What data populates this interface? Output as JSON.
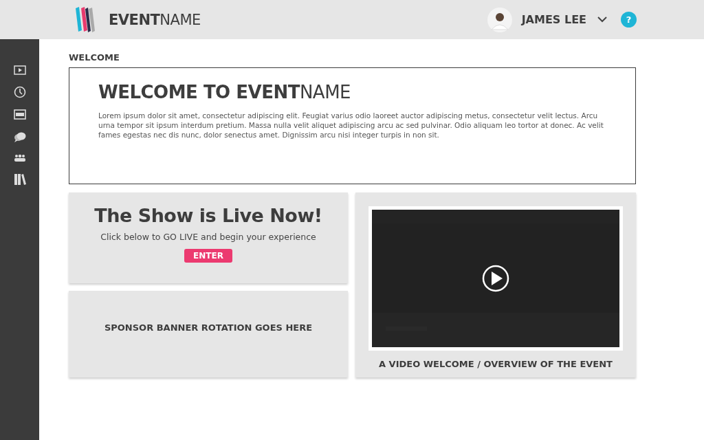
{
  "header": {
    "logo": "**EVENT**NAME",
    "user": {
      "name": "JAMES LEE"
    },
    "help": "?"
  },
  "welcome": {
    "section_label": "WELCOME",
    "title": "**WELCOME TO EVENT**NAME",
    "body": "Lorem ipsum dolor sit amet, consectetur adipiscing elit. Feugiat varius odio laoreet auctor adipiscing metus, consectetur velit lectus. Arcu urna tempor sit ipsum interdum pretium. Massa nulla velit aliquet adipiscing arcu ac sed pulvinar. Odio aliquam leo tortor at donec. Ac velit fames egestas nec dis nunc, dolor senectus amet. Dignissim arcu nisi integer turpis in non sit."
  },
  "live": {
    "title": "The Show is Live Now!",
    "subtitle": "Click below to GO LIVE and begin your experience",
    "button": "ENTER"
  },
  "sponsor": {
    "text": "SPONSOR BANNER ROTATION GOES HERE"
  },
  "video": {
    "kind": "picture",
    "caption": "A VIDEO WELCOME / OVERVIEW OF THE EVENT"
  }
}
